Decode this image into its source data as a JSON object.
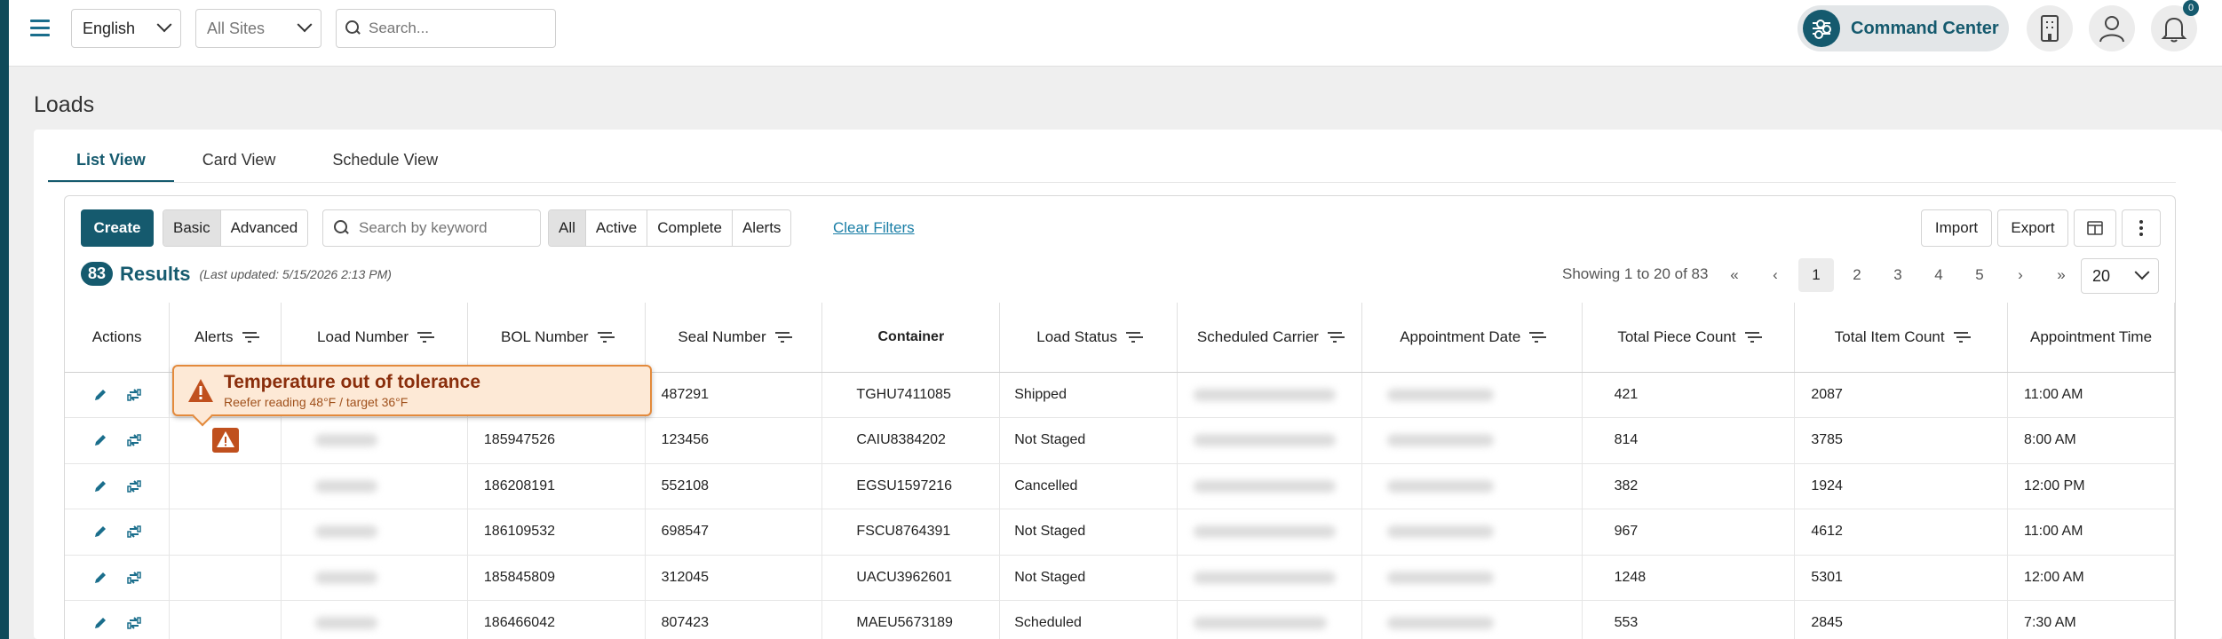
{
  "topbar": {
    "language": "English",
    "site": "All Sites",
    "search_placeholder": "Search...",
    "command_center": "Command Center",
    "notification_badge": "0"
  },
  "page": {
    "title": "Loads"
  },
  "tabs": [
    "List View",
    "Card View",
    "Schedule View"
  ],
  "toolbar": {
    "create": "Create",
    "mode": [
      "Basic",
      "Advanced"
    ],
    "keyword_placeholder": "Search by keyword",
    "filters": [
      "All",
      "Active",
      "Complete",
      "Alerts"
    ],
    "clear_filters": "Clear Filters",
    "import": "Import",
    "export": "Export"
  },
  "results": {
    "count": "83",
    "label": "Results",
    "updated": "(Last updated: 5/15/2026 2:13 PM)",
    "showing": "Showing 1 to 20 of 83",
    "pages": [
      "1",
      "2",
      "3",
      "4",
      "5"
    ],
    "per_page": "20"
  },
  "alert": {
    "title": "Temperature out of tolerance",
    "subtitle": "Reefer reading 48°F / target 36°F"
  },
  "table": {
    "headers": [
      "Actions",
      "Alerts",
      "Load Number",
      "BOL Number",
      "Seal Number",
      "Container",
      "Load Status",
      "Scheduled Carrier",
      "Appointment Date",
      "Total Piece Count",
      "Total Item Count",
      "Appointment Time"
    ],
    "rows": [
      {
        "bol": "",
        "seal": "487291",
        "container": "TGHU7411085",
        "status": "Shipped",
        "pieces": "421",
        "items": "2087",
        "time": "11:00 AM"
      },
      {
        "bol": "185947526",
        "seal": "123456",
        "container": "CAIU8384202",
        "status": "Not Staged",
        "pieces": "814",
        "items": "3785",
        "time": "8:00 AM"
      },
      {
        "bol": "186208191",
        "seal": "552108",
        "container": "EGSU1597216",
        "status": "Cancelled",
        "pieces": "382",
        "items": "1924",
        "time": "12:00 PM"
      },
      {
        "bol": "186109532",
        "seal": "698547",
        "container": "FSCU8764391",
        "status": "Not Staged",
        "pieces": "967",
        "items": "4612",
        "time": "11:00 AM"
      },
      {
        "bol": "185845809",
        "seal": "312045",
        "container": "UACU3962601",
        "status": "Not Staged",
        "pieces": "1248",
        "items": "5301",
        "time": "12:00 AM"
      },
      {
        "bol": "186466042",
        "seal": "807423",
        "container": "MAEU5673189",
        "status": "Scheduled",
        "pieces": "553",
        "items": "2845",
        "time": "7:30 AM"
      }
    ]
  },
  "colors": {
    "primary": "#155a6e",
    "link": "#1a7ea6",
    "alert": "#c0501e",
    "alert_bg": "#fde9d6"
  }
}
